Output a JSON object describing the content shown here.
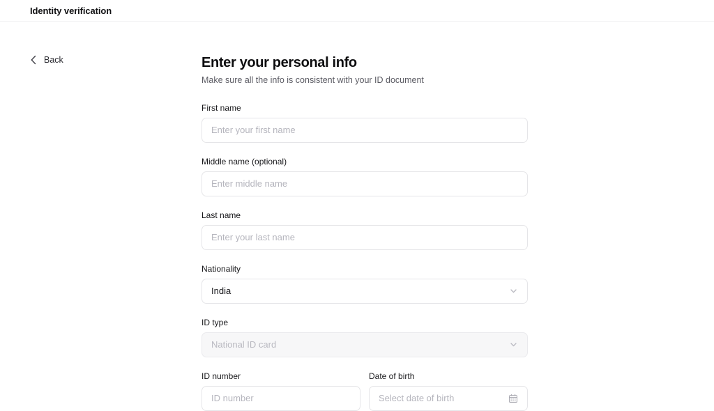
{
  "appbar": {
    "title": "Identity verification"
  },
  "nav": {
    "back_label": "Back",
    "back_icon": "chevron-left-icon"
  },
  "main": {
    "heading": "Enter your personal info",
    "subheading": "Make sure all the info is consistent with your ID document",
    "fields": {
      "first_name": {
        "label": "First name",
        "placeholder": "Enter your first name",
        "value": ""
      },
      "middle_name": {
        "label": "Middle name (optional)",
        "placeholder": "Enter middle name",
        "value": ""
      },
      "last_name": {
        "label": "Last name",
        "placeholder": "Enter your last name",
        "value": ""
      },
      "nationality": {
        "label": "Nationality",
        "value": "India",
        "icon": "chevron-down-icon"
      },
      "id_type": {
        "label": "ID type",
        "placeholder": "National ID card",
        "value": "",
        "icon": "chevron-down-icon",
        "disabled": "true"
      },
      "id_number": {
        "label": "ID number",
        "placeholder": "ID number",
        "value": ""
      },
      "date_of_birth": {
        "label": "Date of birth",
        "placeholder": "Select date of birth",
        "value": "",
        "icon": "calendar-icon"
      }
    }
  },
  "colors": {
    "page_background": "#ffffff",
    "text_primary": "#18181b",
    "text_muted": "#5b5b63",
    "placeholder": "#b5b5bd",
    "border": "#e5e5e8",
    "disabled_background": "#f7f7f8"
  }
}
